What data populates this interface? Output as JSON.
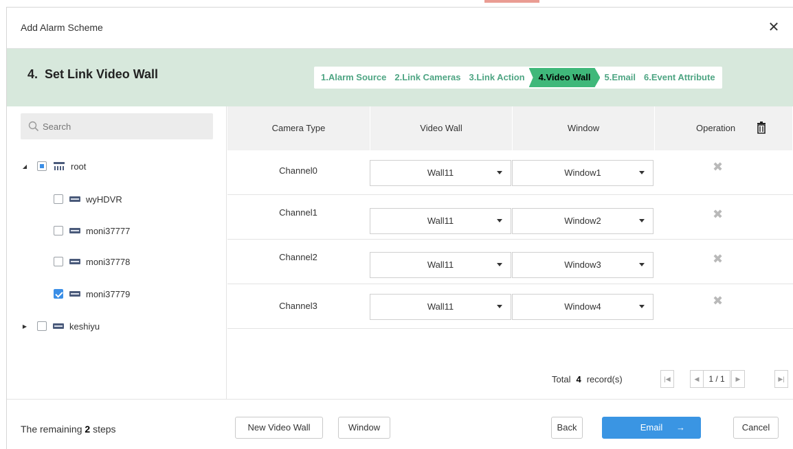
{
  "dialog": {
    "title": "Add Alarm Scheme",
    "close_icon": "close-icon",
    "close_glyph": "✕"
  },
  "stepbar": {
    "step_number": "4.",
    "heading": "Set Link Video Wall",
    "steps": [
      {
        "label": "1.Alarm Source",
        "active": false
      },
      {
        "label": "2.Link Cameras",
        "active": false
      },
      {
        "label": "3.Link Action",
        "active": false
      },
      {
        "label": "4.Video Wall",
        "active": true
      },
      {
        "label": "5.Email",
        "active": false
      },
      {
        "label": "6.Event Attribute",
        "active": false
      }
    ],
    "colors": {
      "bar_bg": "#d7e8dc",
      "active": "#3fb87a",
      "inactive_text": "#4ea583"
    }
  },
  "search": {
    "placeholder": "Search",
    "icon": "search-icon"
  },
  "tree": {
    "root": {
      "label": "root",
      "state": "partial",
      "expanded": true,
      "icon": "network-icon"
    },
    "children": [
      {
        "label": "wyHDVR",
        "checked": false,
        "icon": "device-icon"
      },
      {
        "label": "moni37777",
        "checked": false,
        "icon": "device-icon"
      },
      {
        "label": "moni37778",
        "checked": false,
        "icon": "device-icon"
      },
      {
        "label": "moni37779",
        "checked": true,
        "icon": "device-icon"
      },
      {
        "label": "keshiyu",
        "checked": false,
        "icon": "device-icon",
        "collapsed": true
      }
    ],
    "glyphs": {
      "expanded": "◢",
      "collapsed": "▶"
    }
  },
  "table": {
    "columns": [
      "Camera Type",
      "Video Wall",
      "Window",
      "Operation"
    ],
    "delete_all_icon": "trash-icon",
    "rows": [
      {
        "camera_type": "Channel0",
        "video_wall": "Wall11",
        "window": "Window1"
      },
      {
        "camera_type": "Channel1",
        "video_wall": "Wall11",
        "window": "Window2"
      },
      {
        "camera_type": "Channel2",
        "video_wall": "Wall11",
        "window": "Window3"
      },
      {
        "camera_type": "Channel3",
        "video_wall": "Wall11",
        "window": "Window4"
      }
    ],
    "row_delete_icon": "close-x-icon",
    "row_delete_glyph": "✖"
  },
  "pager": {
    "total_prefix": "Total",
    "total_count": "4",
    "total_suffix": "record(s)",
    "page": "1 / 1",
    "first_glyph": "|◀",
    "prev_glyph": "◀",
    "next_glyph": "▶",
    "last_glyph": "▶|"
  },
  "footer": {
    "remaining_prefix": "The remaining",
    "remaining_count": "2",
    "remaining_suffix": "steps",
    "new_video_wall": "New Video Wall",
    "window": "Window",
    "back": "Back",
    "next_label": "Email",
    "next_arrow": "→",
    "cancel": "Cancel"
  },
  "colors": {
    "primary": "#3a95e3",
    "checkbox": "#3a8ee6"
  }
}
